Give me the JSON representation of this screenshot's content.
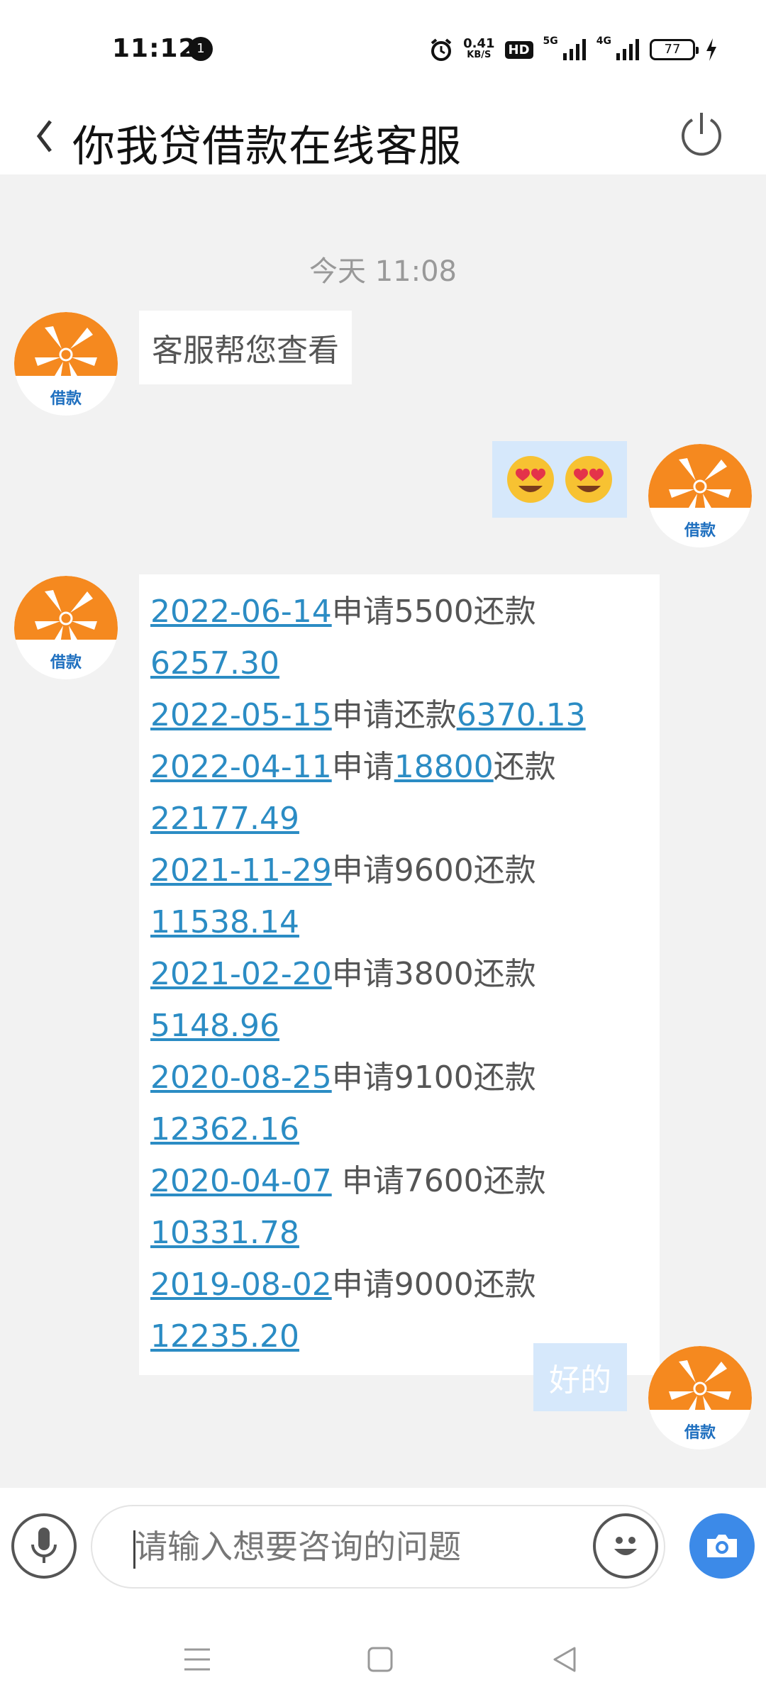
{
  "status_bar": {
    "time": "11:12",
    "notification_count": "1",
    "net_speed_value": "0.41",
    "net_speed_unit": "KB/S",
    "hd_label": "HD",
    "signal1_label": "5G",
    "signal2_label": "4G",
    "battery_level": "77"
  },
  "header": {
    "title": "你我贷借款在线客服"
  },
  "chat": {
    "timestamp": "今天 11:08",
    "avatar_label": "借款",
    "msg_agent_1": "客服帮您查看",
    "msg_user_emoji_count": 2,
    "records": [
      {
        "date": "2022-06-14",
        "t1": "申请5500还款",
        "amount": "6257.30"
      },
      {
        "date": "2022-05-15",
        "t1": "申请还款",
        "amount": "6370.13"
      },
      {
        "date": "2022-04-11",
        "t1": "申请",
        "link2": "18800",
        "t2": "还款",
        "amount": "22177.49"
      },
      {
        "date": "2021-11-29",
        "t1": "申请9600还款",
        "amount": "11538.14"
      },
      {
        "date": "2021-02-20",
        "t1": "申请3800还款",
        "amount": "5148.96"
      },
      {
        "date": "2020-08-25",
        "t1": "申请9100还款",
        "amount": "12362.16"
      },
      {
        "date": "2020-04-07",
        "t1": " 申请7600还款",
        "amount": "10331.78"
      },
      {
        "date": "2019-08-02",
        "t1": "申请9000还款",
        "amount": "12235.20"
      }
    ],
    "msg_user_2": "好的"
  },
  "input": {
    "placeholder": "请输入想要咨询的问题"
  },
  "colors": {
    "accent_orange": "#f5891f",
    "link_blue": "#2b8cc4",
    "camera_blue": "#3c8ae8",
    "user_bubble": "#d6e8fb"
  },
  "icons": [
    "back-icon",
    "power-icon",
    "mic-icon",
    "smiley-icon",
    "camera-icon",
    "alarm-icon",
    "signal-icon",
    "battery-icon",
    "menu-icon",
    "home-icon",
    "back-triangle-icon"
  ]
}
